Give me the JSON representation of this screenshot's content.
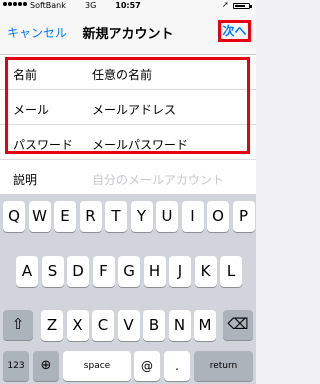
{
  "status_bar": {
    "carrier": "SoftBank",
    "network": "3G",
    "time": "10:57",
    "battery_level": 0.8
  },
  "nav": {
    "cancel": "キャンセル",
    "title": "新規アカウント",
    "next": "次へ"
  },
  "form": {
    "rows": [
      {
        "label": "名前",
        "value": "任意の名前"
      },
      {
        "label": "メール",
        "value": "メールアドレス"
      },
      {
        "label": "パスワード",
        "value": "メールパスワード"
      },
      {
        "label": "説明",
        "placeholder": "自分のメールアカウント"
      }
    ]
  },
  "keyboard": {
    "row1": [
      "Q",
      "W",
      "E",
      "R",
      "T",
      "Y",
      "U",
      "I",
      "O",
      "P"
    ],
    "row2": [
      "A",
      "S",
      "D",
      "F",
      "G",
      "H",
      "J",
      "K",
      "L"
    ],
    "row3": [
      "Z",
      "X",
      "C",
      "V",
      "B",
      "N",
      "M"
    ],
    "shift_icon": "shift-icon",
    "delete_icon": "delete-icon",
    "globe_icon": "globe-icon",
    "numbers": "123",
    "space": "space",
    "at": "@",
    "period": ".",
    "return": "return"
  }
}
